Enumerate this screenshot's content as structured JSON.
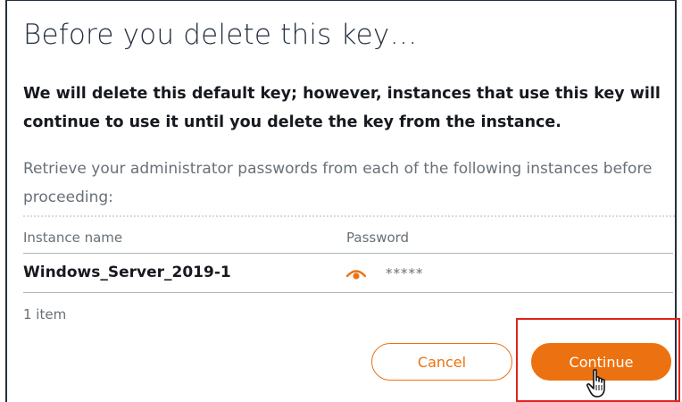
{
  "dialog": {
    "title": "Before you delete this key…",
    "warning": "We will delete this default key; however, instances that use this key will continue to use it until you delete the key from the instance.",
    "instructions": "Retrieve your administrator passwords from each of the following instances before proceeding:"
  },
  "table": {
    "columns": {
      "name": "Instance name",
      "password": "Password"
    },
    "rows": [
      {
        "name": "Windows_Server_2019-1",
        "password": "*****"
      }
    ],
    "count": "1 item"
  },
  "actions": {
    "cancel_label": "Cancel",
    "continue_label": "Continue"
  },
  "colors": {
    "accent": "#ec7211",
    "highlight": "#e0241b"
  },
  "icons": {
    "password_toggle": "eye-icon",
    "cursor": "hand-pointer-icon"
  }
}
